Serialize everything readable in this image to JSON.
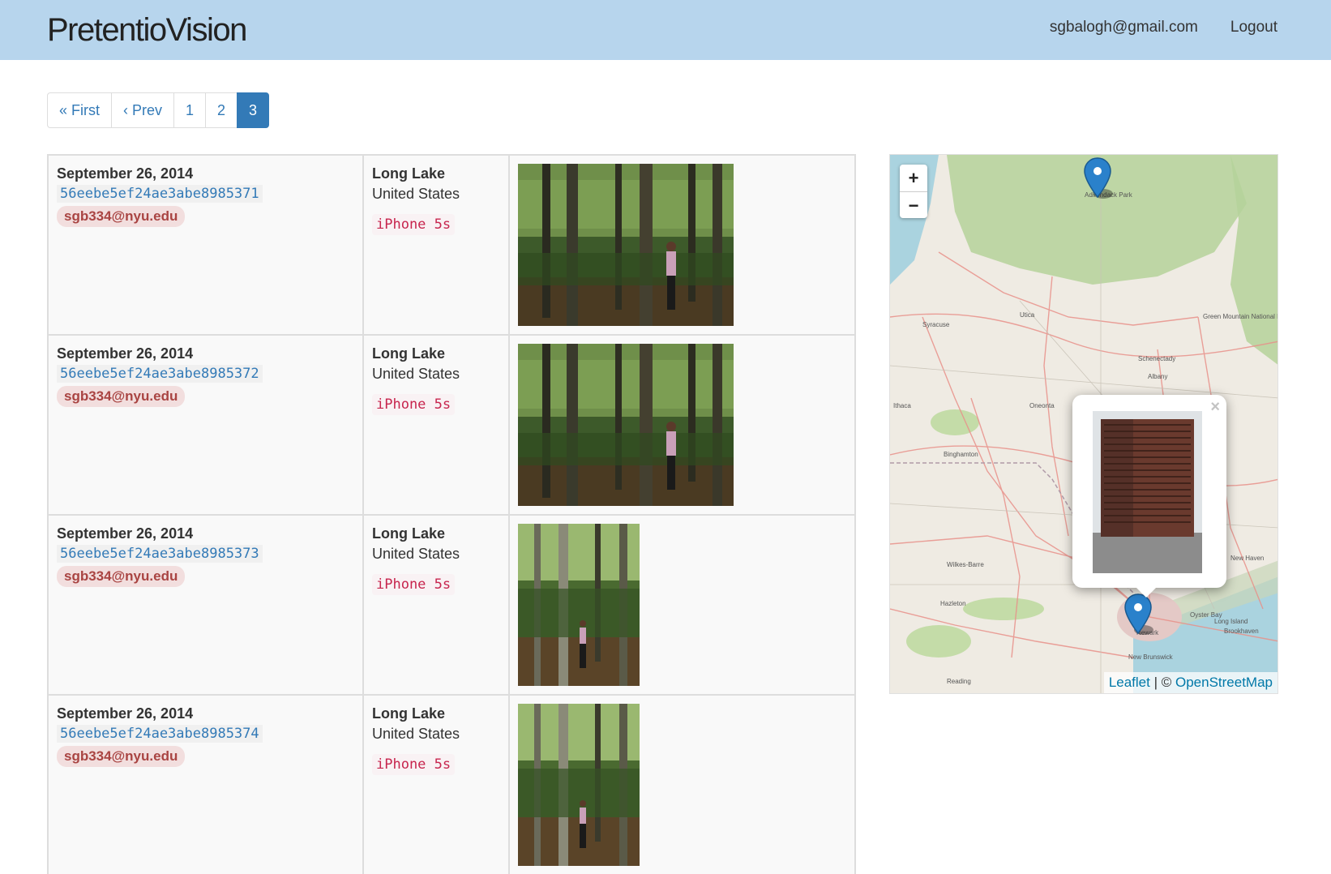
{
  "navbar": {
    "brand": "PretentioVision",
    "user_email": "sgbalogh@gmail.com",
    "logout_label": "Logout"
  },
  "pagination": {
    "first": "« First",
    "prev": "‹ Prev",
    "pages": [
      "1",
      "2",
      "3"
    ],
    "current": "3"
  },
  "photos": [
    {
      "date": "September 26, 2014",
      "id": "56eebe5ef24ae3abe8985371",
      "email": "sgb334@nyu.edu",
      "city": "Long Lake",
      "country": "United States",
      "device": "iPhone 5s",
      "orientation": "landscape"
    },
    {
      "date": "September 26, 2014",
      "id": "56eebe5ef24ae3abe8985372",
      "email": "sgb334@nyu.edu",
      "city": "Long Lake",
      "country": "United States",
      "device": "iPhone 5s",
      "orientation": "landscape"
    },
    {
      "date": "September 26, 2014",
      "id": "56eebe5ef24ae3abe8985373",
      "email": "sgb334@nyu.edu",
      "city": "Long Lake",
      "country": "United States",
      "device": "iPhone 5s",
      "orientation": "portrait"
    },
    {
      "date": "September 26, 2014",
      "id": "56eebe5ef24ae3abe8985374",
      "email": "sgb334@nyu.edu",
      "city": "Long Lake",
      "country": "United States",
      "device": "iPhone 5s",
      "orientation": "portrait"
    }
  ],
  "map": {
    "zoom_in": "+",
    "zoom_out": "−",
    "popup_close": "×",
    "attribution_leaflet": "Leaflet",
    "attribution_sep": " | © ",
    "attribution_osm": "OpenStreetMap",
    "labels": [
      "Adirondack Park",
      "Syracuse",
      "Utica",
      "Schenectady",
      "Albany",
      "Oneonta",
      "Ithaca",
      "Binghamton",
      "Green Mountain National Forest",
      "Long Island",
      "Brookhaven",
      "Oyster Bay",
      "Newark",
      "New Brunswick",
      "Reading",
      "Wilkes-Barre",
      "Hazleton",
      "New Haven"
    ]
  },
  "colors": {
    "navbar": "#b7d5ed",
    "link": "#337ab7",
    "badge_text": "#a94442",
    "badge_bg": "#f2dede",
    "code_text": "#c7254e",
    "code_bg": "#f9f2f4",
    "marker": "#2a81cb"
  }
}
